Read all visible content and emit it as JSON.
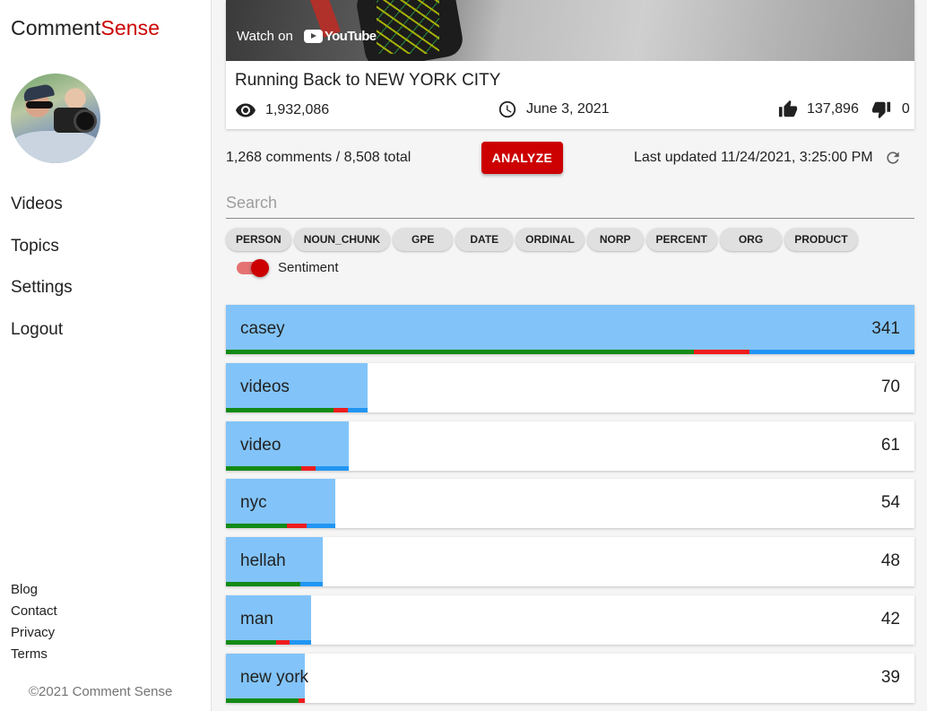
{
  "brand": {
    "prefix": "Comment",
    "accent": "Sense",
    "accent_color": "#cc0000"
  },
  "nav": {
    "items": [
      {
        "label": "Videos"
      },
      {
        "label": "Topics"
      },
      {
        "label": "Settings"
      },
      {
        "label": "Logout"
      }
    ]
  },
  "footer": {
    "links": [
      {
        "label": "Blog"
      },
      {
        "label": "Contact"
      },
      {
        "label": "Privacy"
      },
      {
        "label": "Terms"
      }
    ],
    "copyright": "©2021 Comment Sense"
  },
  "video": {
    "watch_on": "Watch on",
    "youtube": "YouTube",
    "title": "Running Back to NEW YORK CITY",
    "views": "1,932,086",
    "date": "June 3, 2021",
    "likes": "137,896",
    "dislikes": "0"
  },
  "toolbar": {
    "comment_count": "1,268 comments / 8,508 total",
    "analyze_label": "ANALYZE",
    "last_updated": "Last updated 11/24/2021, 3:25:00 PM"
  },
  "search": {
    "placeholder": "Search",
    "value": ""
  },
  "entity_filters": [
    {
      "label": "PERSON"
    },
    {
      "label": "NOUN_CHUNK"
    },
    {
      "label": "GPE"
    },
    {
      "label": "DATE"
    },
    {
      "label": "ORDINAL"
    },
    {
      "label": "NORP"
    },
    {
      "label": "PERCENT"
    },
    {
      "label": "ORG"
    },
    {
      "label": "PRODUCT"
    }
  ],
  "sentiment_toggle": {
    "label": "Sentiment",
    "on": true
  },
  "colors": {
    "bar_fill": "#82c4f9",
    "positive": "#138a16",
    "negative": "#ee1c1c",
    "neutral": "#2196f3"
  },
  "topics": [
    {
      "label": "casey",
      "count": 341,
      "sentiment": {
        "positive": 0.68,
        "negative": 0.08,
        "neutral": 0.24
      }
    },
    {
      "label": "videos",
      "count": 70,
      "sentiment": {
        "positive": 0.76,
        "negative": 0.1,
        "neutral": 0.14
      }
    },
    {
      "label": "video",
      "count": 61,
      "sentiment": {
        "positive": 0.61,
        "negative": 0.12,
        "neutral": 0.27
      }
    },
    {
      "label": "nyc",
      "count": 54,
      "sentiment": {
        "positive": 0.56,
        "negative": 0.18,
        "neutral": 0.26
      }
    },
    {
      "label": "hellah",
      "count": 48,
      "sentiment": {
        "positive": 0.77,
        "negative": 0.0,
        "neutral": 0.23
      }
    },
    {
      "label": "man",
      "count": 42,
      "sentiment": {
        "positive": 0.59,
        "negative": 0.16,
        "neutral": 0.25
      }
    },
    {
      "label": "new york",
      "count": 39,
      "sentiment": {
        "positive": 0.92,
        "negative": 0.08,
        "neutral": 0.0
      }
    }
  ]
}
